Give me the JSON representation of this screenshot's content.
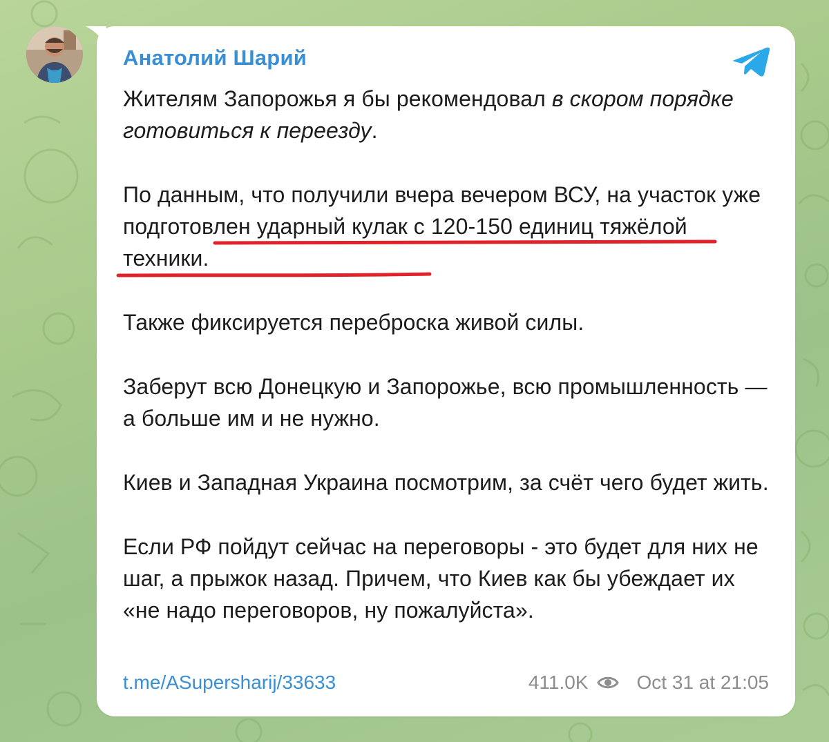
{
  "post": {
    "author": "Анатолий Шарий",
    "paragraph1_plain": "Жителям Запорожья я бы рекомендовал ",
    "paragraph1_italic": "в скором порядке готовиться к переезду",
    "paragraph1_end": ".",
    "paragraph2": "По данным, что получили вчера вечером ВСУ, на участок уже подготовлен ударный кулак с 120-150 единиц тяжёлой техники.",
    "paragraph3": "Также фиксируется переброска живой силы.",
    "paragraph4": "Заберут всю Донецкую и Запорожье, всю промышленность — а больше им и не нужно.",
    "paragraph5": "Киев и Западная Украина посмотрим, за счёт чего будет жить.",
    "paragraph6": "Если РФ пойдут сейчас на переговоры - это будет для них не шаг, а прыжок назад. Причем, что Киев как бы убеждает их «не надо переговоров, ну пожалуйста».",
    "link": "t.me/ASupersharij/33633",
    "views": "411.0K",
    "timestamp": "Oct 31 at 21:05"
  },
  "icons": {
    "avatar": "author-avatar",
    "telegram": "telegram-plane-icon",
    "views": "eye-icon"
  },
  "colors": {
    "author": "#3a8fd4",
    "link": "#3a8fd4",
    "underline": "#e0232a",
    "background": "#a7c98a",
    "bubble": "#ffffff",
    "meta": "#8d8d8d"
  }
}
